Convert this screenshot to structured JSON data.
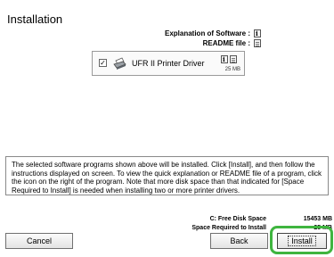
{
  "window": {
    "title": "Installation"
  },
  "legend": {
    "explanation_label": "Explanation of Software :",
    "readme_label": "README file :"
  },
  "program": {
    "name": "UFR II Printer Driver",
    "size": "25 MB",
    "checked": true
  },
  "description": "The selected software programs shown above will be installed. Click [Install], and then follow the instructions displayed on screen. To view the quick explanation or README file of a program, click the icon on the right of the program. Note that more disk space than that indicated for [Space Required to Install] is needed when installing two or more printer drivers.",
  "disk": {
    "free_label": "C: Free Disk Space",
    "free_value": "15453 MB",
    "required_label": "Space Required to Install",
    "required_value": "25 MB"
  },
  "buttons": {
    "cancel": "Cancel",
    "back": "Back",
    "install": "Install"
  }
}
